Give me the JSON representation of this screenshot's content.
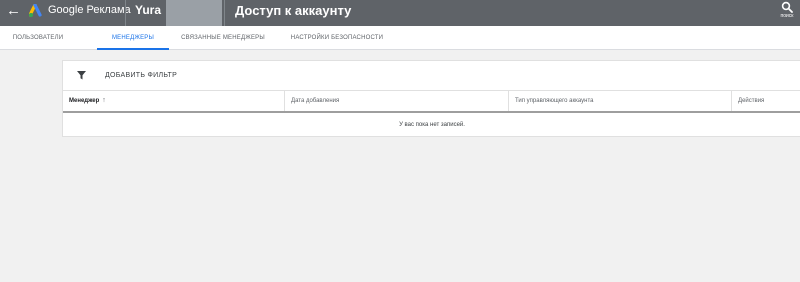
{
  "header": {
    "back_label": "←",
    "brand": "Google Реклама",
    "account": "Yura",
    "title": "Доступ к аккаунту",
    "search_label": "поиск"
  },
  "tabs": [
    {
      "label": "ПОЛЬЗОВАТЕЛИ",
      "active": false
    },
    {
      "label": "МЕНЕДЖЕРЫ",
      "active": true
    },
    {
      "label": "СВЯЗАННЫЕ МЕНЕДЖЕРЫ",
      "active": false
    },
    {
      "label": "НАСТРОЙКИ БЕЗОПАСНОСТИ",
      "active": false
    }
  ],
  "toolbar": {
    "add_filter_label": "ДОБАВИТЬ ФИЛЬТР"
  },
  "table": {
    "columns": [
      "Менеджер",
      "Дата добавления",
      "Тип управляющего аккаунта",
      "Действия"
    ],
    "sort_indicator": "↑",
    "empty_message": "У вас пока нет записей."
  },
  "colors": {
    "header_bg": "#5f6368",
    "accent": "#1a73e8",
    "page_bg": "#f1f1f1"
  }
}
